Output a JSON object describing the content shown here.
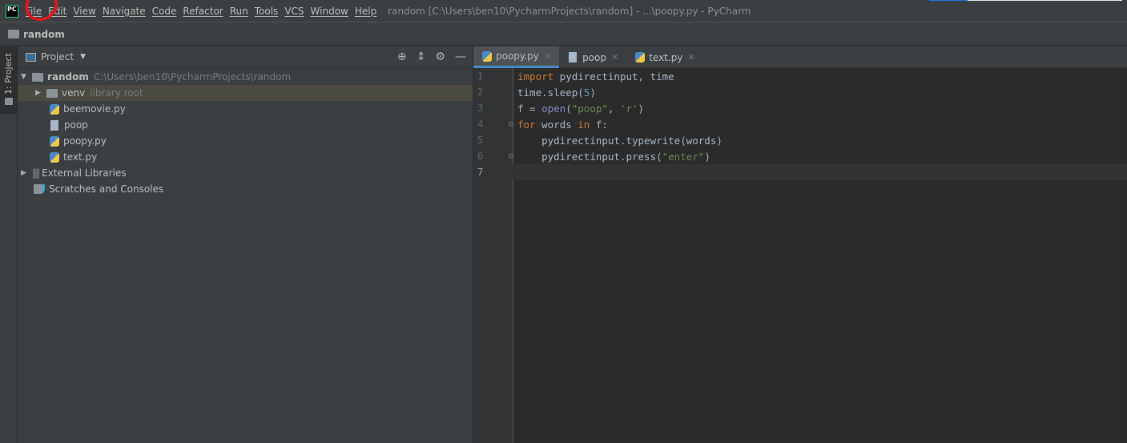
{
  "window_title": "random [C:\\Users\\ben10\\PycharmProjects\\random] - ...\\poopy.py - PyCharm",
  "logo": "PC",
  "menu": [
    "File",
    "Edit",
    "View",
    "Navigate",
    "Code",
    "Refactor",
    "Run",
    "Tools",
    "VCS",
    "Window",
    "Help"
  ],
  "navbar": {
    "project": "random"
  },
  "sidebar_strip": {
    "tab": "1: Project"
  },
  "project_panel": {
    "title": "Project",
    "tree": [
      {
        "label": "random",
        "hint": "C:\\Users\\ben10\\PycharmProjects\\random"
      },
      {
        "label": "venv",
        "hint": "library root"
      },
      {
        "label": "beemovie.py"
      },
      {
        "label": "poop"
      },
      {
        "label": "poopy.py"
      },
      {
        "label": "text.py"
      },
      {
        "label": "External Libraries"
      },
      {
        "label": "Scratches and Consoles"
      }
    ]
  },
  "editor": {
    "tabs": [
      {
        "label": "poopy.py",
        "active": true
      },
      {
        "label": "poop"
      },
      {
        "label": "text.py"
      }
    ],
    "lines": [
      "1",
      "2",
      "3",
      "4",
      "5",
      "6",
      "7"
    ],
    "code": {
      "l1": [
        "import",
        " pydirectinput, time"
      ],
      "l2": [
        "time.sleep(",
        "5",
        ")"
      ],
      "l3": [
        "f = ",
        "open",
        "(",
        "\"poop\"",
        ", ",
        "'r'",
        ")"
      ],
      "l4": [
        "for",
        " words ",
        "in",
        " f:"
      ],
      "l5": "    pydirectinput.typewrite(words)",
      "l6": [
        "    pydirectinput.press(",
        "\"enter\"",
        ")"
      ]
    }
  },
  "colors": {
    "annotation": "#e8141c",
    "accent": "#4a88c7",
    "progress": "#1a78d4"
  }
}
